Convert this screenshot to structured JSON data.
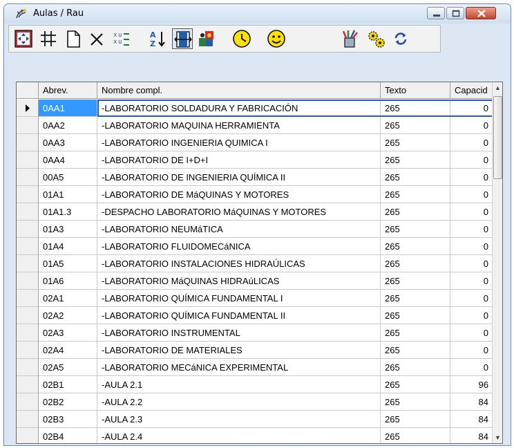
{
  "window": {
    "title": "Aulas / Rau"
  },
  "toolbar": {
    "buttons": [
      {
        "name": "navigate-icon"
      },
      {
        "name": "grid-icon"
      },
      {
        "name": "new-document-icon"
      },
      {
        "name": "delete-icon"
      },
      {
        "name": "transfer-icon"
      },
      {
        "name": "sort-az-icon"
      },
      {
        "name": "columns-icon",
        "pressed": true
      },
      {
        "name": "puzzle-icon"
      },
      {
        "name": "clock-icon"
      },
      {
        "name": "smiley-icon"
      },
      {
        "name": "tools-cup-icon"
      },
      {
        "name": "gears-icon"
      },
      {
        "name": "refresh-icon"
      }
    ]
  },
  "grid": {
    "columns": [
      "Abrev.",
      "Nombre compl.",
      "Texto",
      "Capacid"
    ],
    "selected_row": 0,
    "rows": [
      {
        "abrev": "0AA1",
        "nombre": "-LABORATORIO SOLDADURA Y FABRICACIÓN",
        "texto": "265",
        "capacidad": "0"
      },
      {
        "abrev": "0AA2",
        "nombre": "-LABORATORIO MAQUINA HERRAMIENTA",
        "texto": "265",
        "capacidad": "0"
      },
      {
        "abrev": "0AA3",
        "nombre": "-LABORATORIO INGENIERIA QUIMICA I",
        "texto": "265",
        "capacidad": "0"
      },
      {
        "abrev": "0AA4",
        "nombre": "-LABORATORIO DE I+D+I",
        "texto": "265",
        "capacidad": "0"
      },
      {
        "abrev": "00A5",
        "nombre": "-LABORATORIO DE INGENIERIA  QUÍMICA II",
        "texto": "265",
        "capacidad": "0"
      },
      {
        "abrev": "01A1",
        "nombre": "-LABORATORIO DE MáQUINAS Y MOTORES",
        "texto": "265",
        "capacidad": "0"
      },
      {
        "abrev": "01A1.3",
        "nombre": "-DESPACHO LABORATORIO MáQUINAS Y MOTORES",
        "texto": "265",
        "capacidad": "0"
      },
      {
        "abrev": "01A3",
        "nombre": "-LABORATORIO NEUMáTICA",
        "texto": "265",
        "capacidad": "0"
      },
      {
        "abrev": "01A4",
        "nombre": "-LABORATORIO FLUIDOMECáNICA",
        "texto": "265",
        "capacidad": "0"
      },
      {
        "abrev": "01A5",
        "nombre": "-LABORATORIO INSTALACIONES HIDRAÚLICAS",
        "texto": "265",
        "capacidad": "0"
      },
      {
        "abrev": "01A6",
        "nombre": "-LABORATORIO MáQUINAS HIDRAúLICAS",
        "texto": "265",
        "capacidad": "0"
      },
      {
        "abrev": "02A1",
        "nombre": "-LABORATORIO QUÍMICA FUNDAMENTAL I",
        "texto": "265",
        "capacidad": "0"
      },
      {
        "abrev": "02A2",
        "nombre": "-LABORATORIO QUÍMICA FUNDAMENTAL II",
        "texto": "265",
        "capacidad": "0"
      },
      {
        "abrev": "02A3",
        "nombre": "-LABORATORIO INSTRUMENTAL",
        "texto": "265",
        "capacidad": "0"
      },
      {
        "abrev": "02A4",
        "nombre": "-LABORATORIO DE MATERIALES",
        "texto": "265",
        "capacidad": "0"
      },
      {
        "abrev": "02A5",
        "nombre": "-LABORATORIO MECáNICA EXPERIMENTAL",
        "texto": "265",
        "capacidad": "0"
      },
      {
        "abrev": "02B1",
        "nombre": "-AULA 2.1",
        "texto": "265",
        "capacidad": "96"
      },
      {
        "abrev": "02B2",
        "nombre": "-AULA 2.2",
        "texto": "265",
        "capacidad": "84"
      },
      {
        "abrev": "02B3",
        "nombre": "-AULA 2.3",
        "texto": "265",
        "capacidad": "84"
      },
      {
        "abrev": "02B4",
        "nombre": "-AULA 2.4",
        "texto": "265",
        "capacidad": "84"
      }
    ]
  },
  "colors": {
    "selection": "#3399ff",
    "focus_border": "#2a57c8"
  }
}
